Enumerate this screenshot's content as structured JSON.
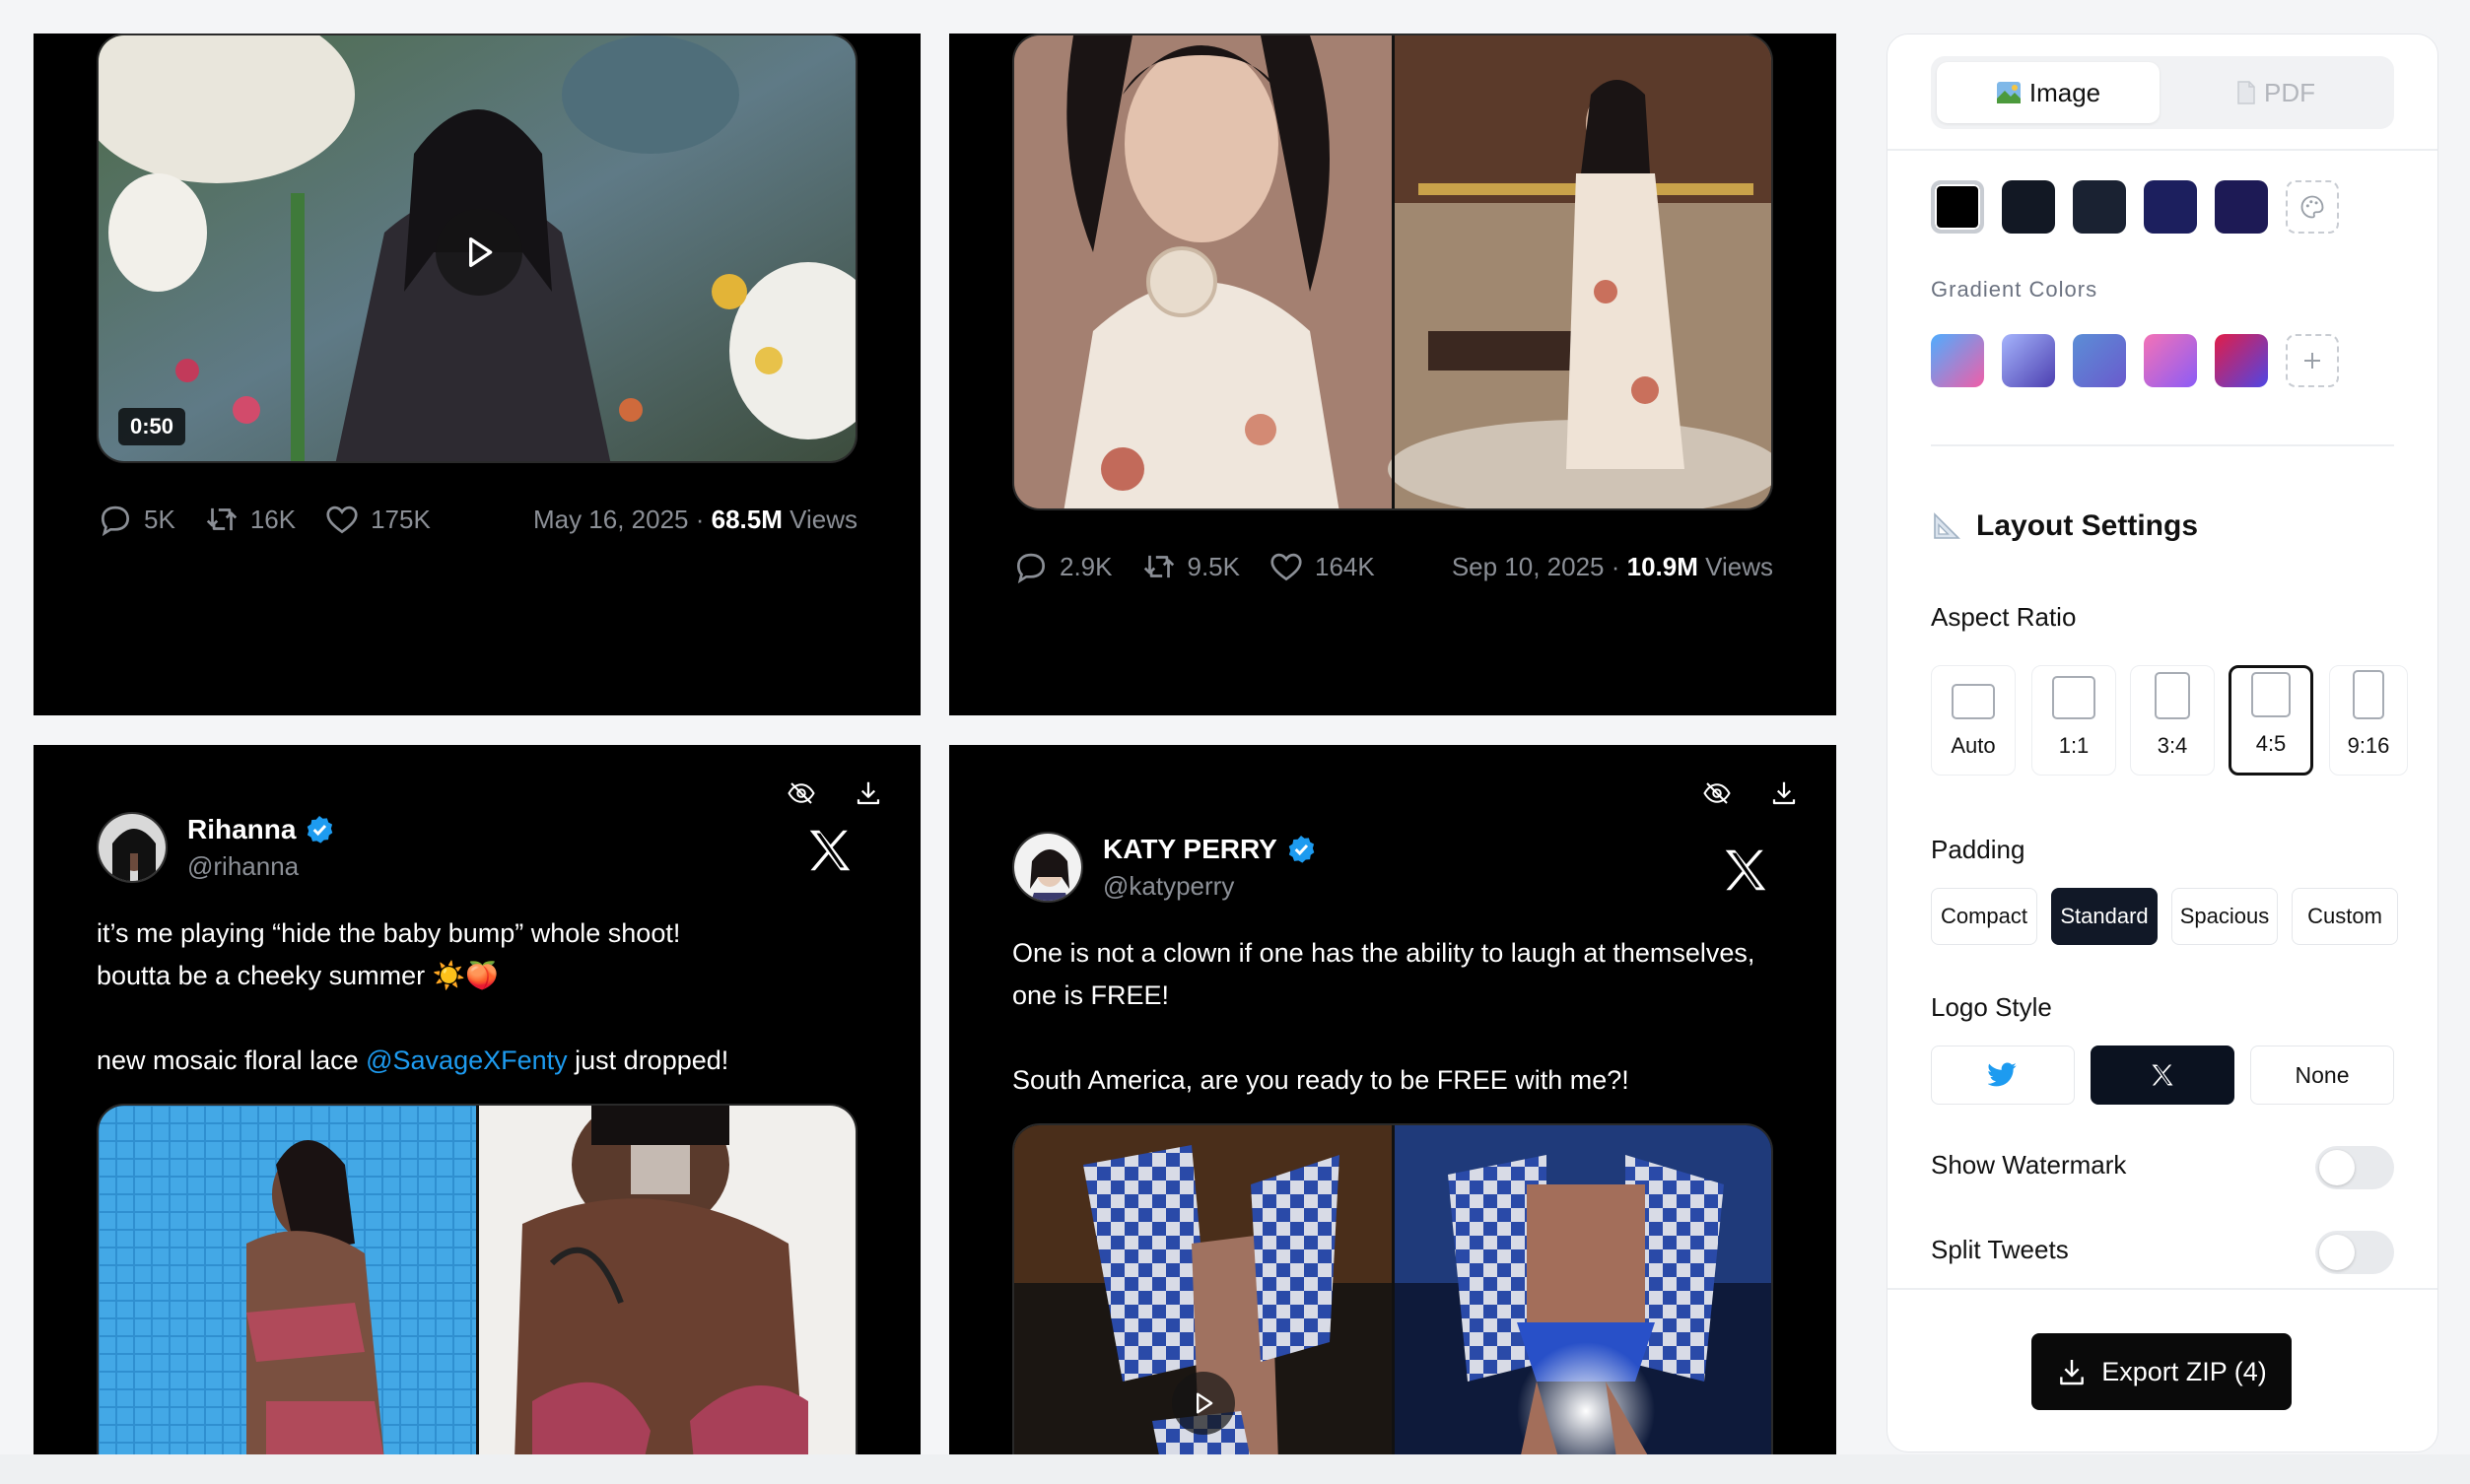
{
  "cards": {
    "c1": {
      "duration": "0:50",
      "replies": "5K",
      "retweets": "16K",
      "likes": "175K",
      "date": "May 16, 2025 · ",
      "views_num": "68.5M",
      "views_word": " Views"
    },
    "c2": {
      "replies": "2.9K",
      "retweets": "9.5K",
      "likes": "164K",
      "date": "Sep 10, 2025 · ",
      "views_num": "10.9M",
      "views_word": " Views"
    },
    "c3": {
      "name": "Rihanna",
      "handle": "@rihanna",
      "line1": "it’s me playing “hide the baby bump” whole shoot!",
      "line2": "boutta be a cheeky summer ☀️🍑",
      "line3_pre": "new mosaic floral lace ",
      "line3_link": "@SavageXFenty",
      "line3_post": " just dropped!"
    },
    "c4": {
      "name": "KATY PERRY",
      "handle": "@katyperry",
      "line1": "One is not a clown if one has the ability to laugh at themselves,",
      "line2": "one is FREE!",
      "line3": "South America, are you ready to be FREE with me?!"
    }
  },
  "sidebar": {
    "tab_image": "Image",
    "tab_pdf": "PDF",
    "solid_colors": [
      "#000000",
      "#121824",
      "#1a2232",
      "#1c1f5e",
      "#1d1a55"
    ],
    "gradient_label": "Gradient Colors",
    "gradients": [
      "linear-gradient(135deg,#4facfe,#f05ea8)",
      "linear-gradient(135deg,#a5b4fc,#4c3fb0)",
      "linear-gradient(135deg,#5b8ed6,#6a5acd)",
      "linear-gradient(135deg,#f472b6,#8b5cf6)",
      "linear-gradient(135deg,#e11d48,#4f46e5)"
    ],
    "layout_title": "Layout Settings",
    "aspect_label": "Aspect Ratio",
    "aspect": [
      "Auto",
      "1:1",
      "3:4",
      "4:5",
      "9:16"
    ],
    "aspect_selected": "4:5",
    "padding_label": "Padding",
    "padding": [
      "Compact",
      "Standard",
      "Spacious",
      "Custom"
    ],
    "padding_selected": "Standard",
    "logo_label": "Logo Style",
    "logo_none": "None",
    "watermark_label": "Show Watermark",
    "split_label": "Split Tweets",
    "export_label": "Export ZIP (4)"
  }
}
